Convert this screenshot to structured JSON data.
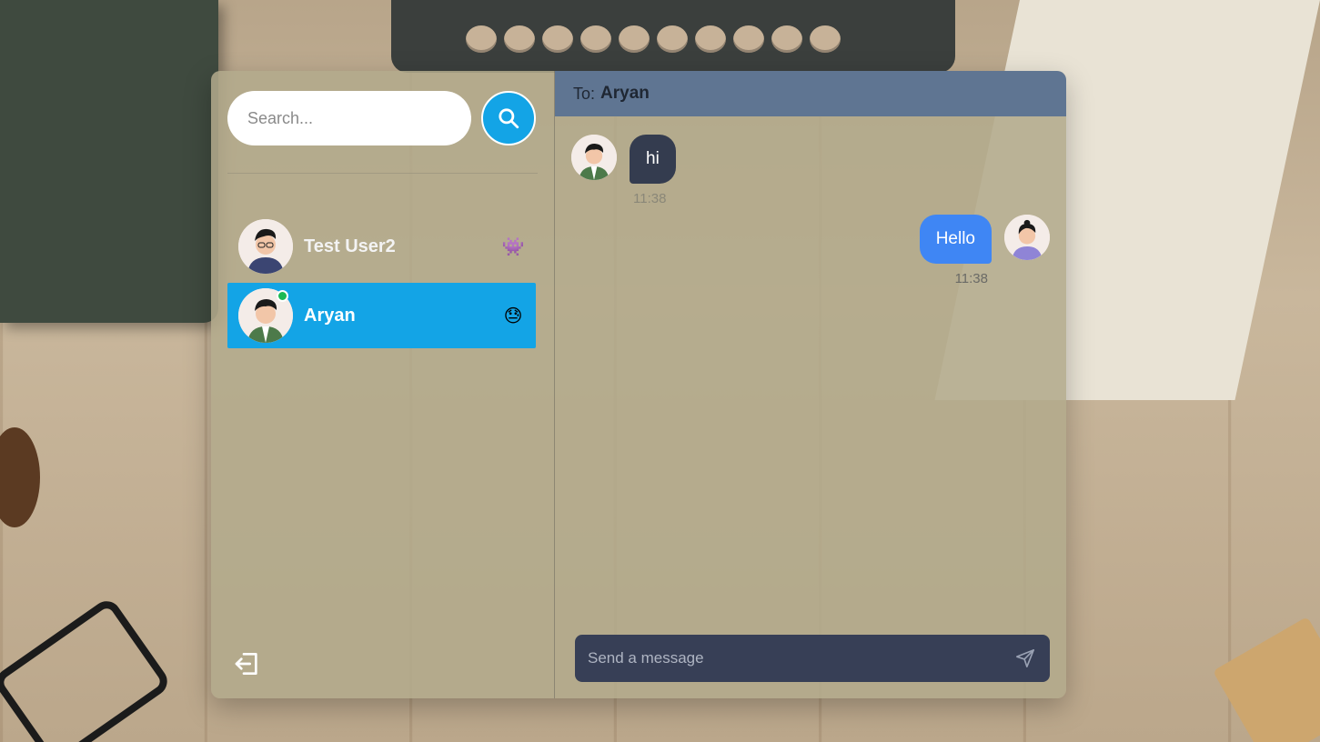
{
  "search": {
    "placeholder": "Search..."
  },
  "contacts": [
    {
      "name": "Test User2",
      "emoji": "👾",
      "online": false,
      "active": false
    },
    {
      "name": "Aryan",
      "emoji": "😓",
      "online": true,
      "active": true
    }
  ],
  "chat": {
    "to_label": "To:",
    "to_name": "Aryan",
    "messages": [
      {
        "direction": "incoming",
        "text": "hi",
        "time": "11:38"
      },
      {
        "direction": "outgoing",
        "text": "Hello",
        "time": "11:38"
      }
    ],
    "composer": {
      "placeholder": "Send a message"
    }
  },
  "icons": {
    "search": "search-icon",
    "logout": "logout-icon",
    "send": "send-icon"
  },
  "colors": {
    "accent": "#13a4e6",
    "header": "#5f7592",
    "bubble_in": "#343c4f",
    "bubble_out": "#3f86f4",
    "composer": "#373f56",
    "online": "#1db954"
  }
}
